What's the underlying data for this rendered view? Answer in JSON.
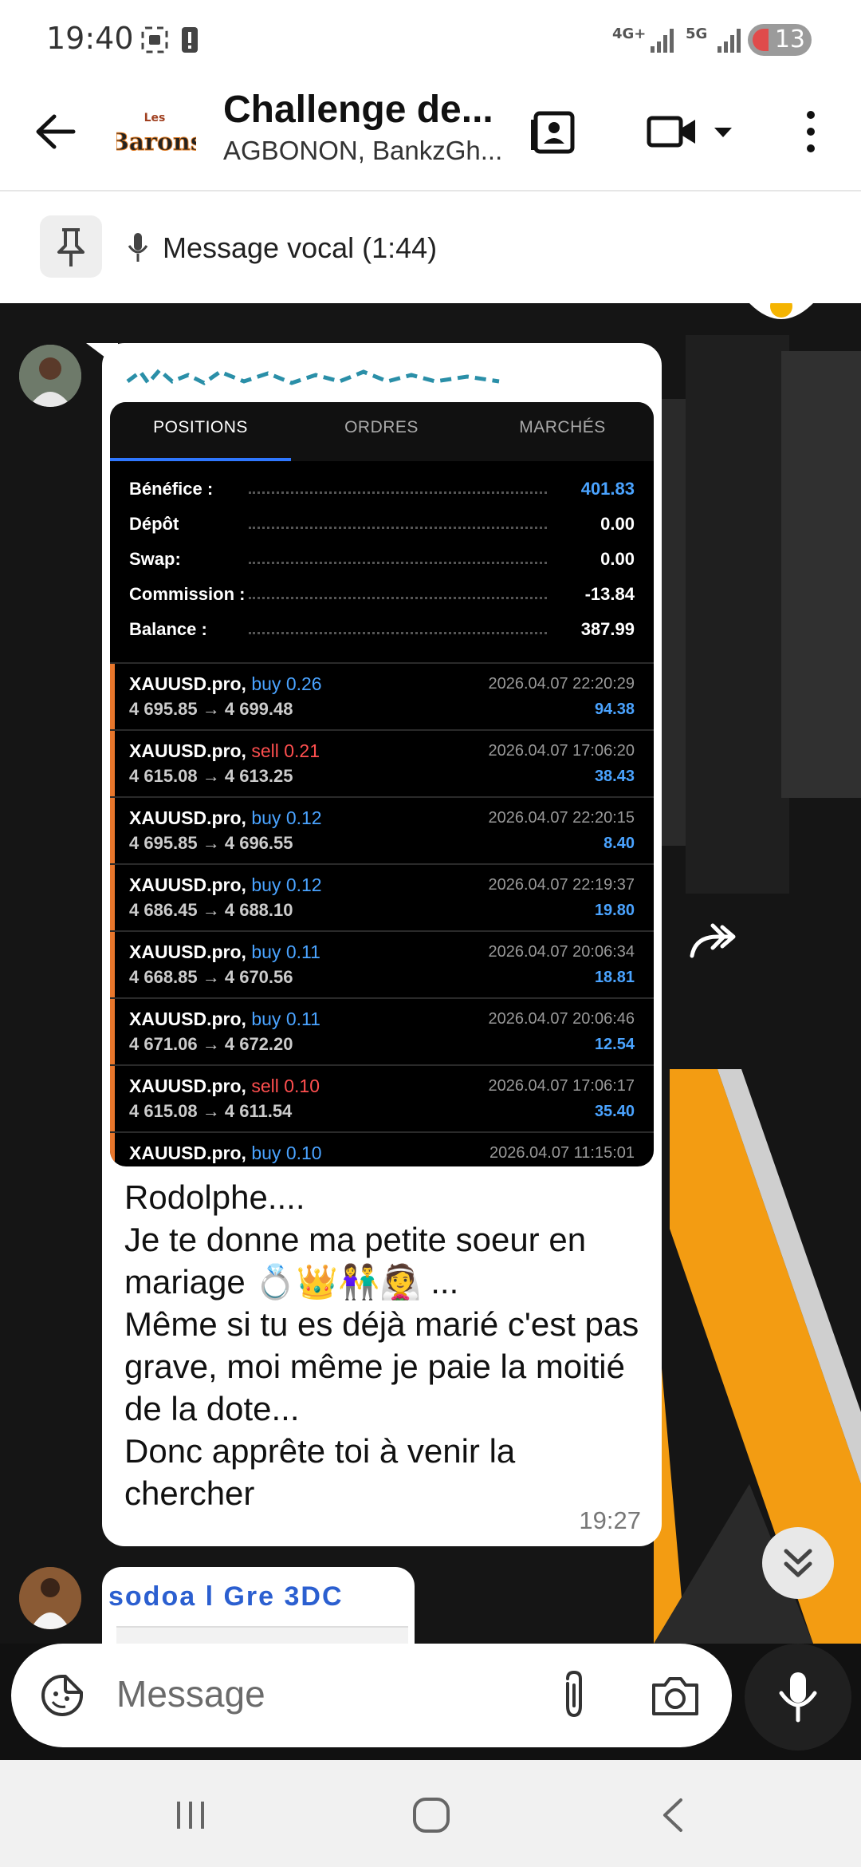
{
  "status_bar": {
    "time": "19:40",
    "network_1": "4G+",
    "network_2": "5G",
    "battery_level": "13"
  },
  "header": {
    "group_logo_text": "Les Barons",
    "title": "Challenge de...",
    "subtitle": "AGBONON, BankzGh..."
  },
  "pinned": {
    "text": "Message vocal (1:44)"
  },
  "trade_screenshot": {
    "tabs": [
      {
        "label": "POSITIONS",
        "active": true
      },
      {
        "label": "ORDRES",
        "active": false
      },
      {
        "label": "MARCHÉS",
        "active": false
      }
    ],
    "summary": [
      {
        "label": "Bénéfice :",
        "value": "401.83"
      },
      {
        "label": "Dépôt",
        "value": "0.00"
      },
      {
        "label": "Swap:",
        "value": "0.00"
      },
      {
        "label": "Commission :",
        "value": "-13.84"
      },
      {
        "label": "Balance :",
        "value": "387.99"
      }
    ],
    "trades": [
      {
        "symbol": "XAUUSD.pro,",
        "side": "buy 0.26",
        "prices": "4 695.85 → 4 699.48",
        "datetime": "2026.04.07 22:20:29",
        "pl": "94.38"
      },
      {
        "symbol": "XAUUSD.pro,",
        "side": "sell 0.21",
        "prices": "4 615.08 → 4 613.25",
        "datetime": "2026.04.07 17:06:20",
        "pl": "38.43"
      },
      {
        "symbol": "XAUUSD.pro,",
        "side": "buy 0.12",
        "prices": "4 695.85 → 4 696.55",
        "datetime": "2026.04.07 22:20:15",
        "pl": "8.40"
      },
      {
        "symbol": "XAUUSD.pro,",
        "side": "buy 0.12",
        "prices": "4 686.45 → 4 688.10",
        "datetime": "2026.04.07 22:19:37",
        "pl": "19.80"
      },
      {
        "symbol": "XAUUSD.pro,",
        "side": "buy 0.11",
        "prices": "4 668.85 → 4 670.56",
        "datetime": "2026.04.07 20:06:34",
        "pl": "18.81"
      },
      {
        "symbol": "XAUUSD.pro,",
        "side": "buy 0.11",
        "prices": "4 671.06 → 4 672.20",
        "datetime": "2026.04.07 20:06:46",
        "pl": "12.54"
      },
      {
        "symbol": "XAUUSD.pro,",
        "side": "sell 0.10",
        "prices": "4 615.08 → 4 611.54",
        "datetime": "2026.04.07 17:06:17",
        "pl": "35.40"
      },
      {
        "symbol": "XAUUSD.pro,",
        "side": "buy 0.10",
        "prices": "",
        "datetime": "2026.04.07 11:15:01",
        "pl": ""
      }
    ]
  },
  "message": {
    "text": "Rodolphe....\nJe te donne ma petite soeur en mariage 💍👑👫👰 ...\nMême si tu es déjà marié c'est pas grave, moi même je paie la moitié de la dote...\nDonc apprête toi à venir la chercher",
    "time": "19:27"
  },
  "next_message": {
    "caption": "sodoa l Gre 3DC"
  },
  "composer": {
    "placeholder": "Message"
  },
  "colors": {
    "buy": "#4aa3ff",
    "sell": "#ff4f4f",
    "accent_orange": "#e8762b",
    "tab_underline": "#2f77ff"
  },
  "icons": [
    "back-arrow-icon",
    "contact-card-icon",
    "video-camera-icon",
    "dropdown-arrow-icon",
    "more-vert-icon",
    "pin-icon",
    "mic-icon",
    "forward-icon",
    "chevron-double-down-icon",
    "sticker-icon",
    "attach-icon",
    "camera-icon",
    "recent-apps-icon",
    "home-icon",
    "back-icon"
  ]
}
